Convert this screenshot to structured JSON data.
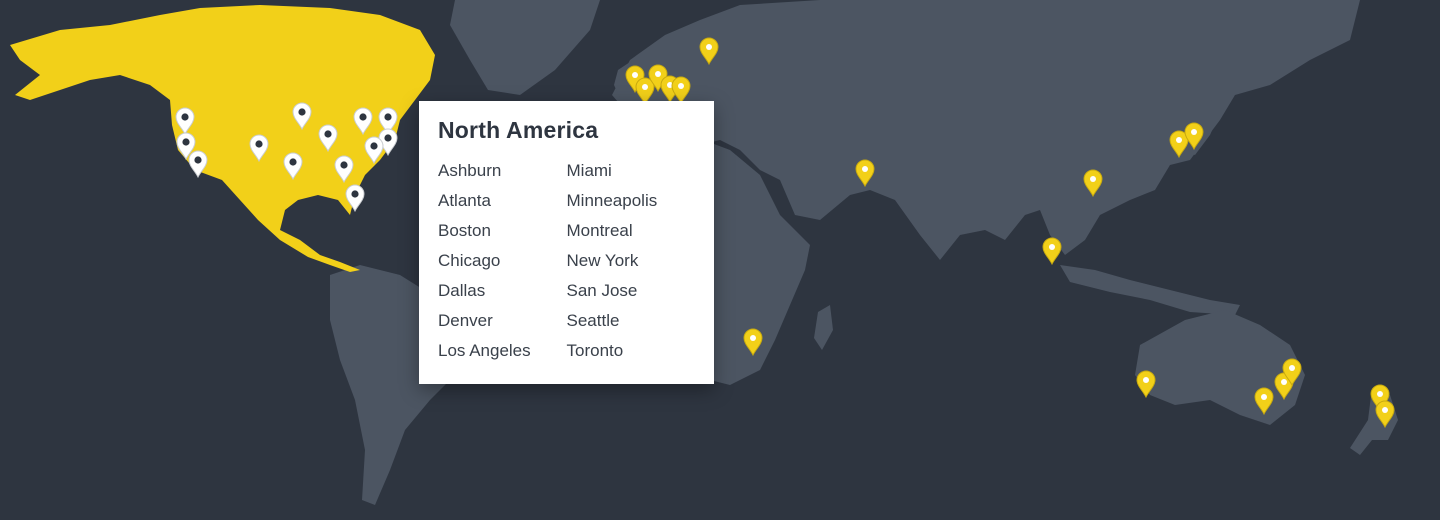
{
  "colors": {
    "background": "#2e3540",
    "land": "#4c5562",
    "highlight": "#f2d019",
    "pin_white": "#ffffff",
    "pin_yellow": "#f2d019",
    "pin_dot": "#2e3540"
  },
  "popup": {
    "title": "North America",
    "cities_left": [
      "Ashburn",
      "Atlanta",
      "Boston",
      "Chicago",
      "Dallas",
      "Denver",
      "Los Angeles"
    ],
    "cities_right": [
      "Miami",
      "Minneapolis",
      "Montreal",
      "New York",
      "San Jose",
      "Seattle",
      "Toronto"
    ]
  },
  "markers": {
    "north_america_style": "white-pin",
    "other_style": "yellow-pin"
  }
}
